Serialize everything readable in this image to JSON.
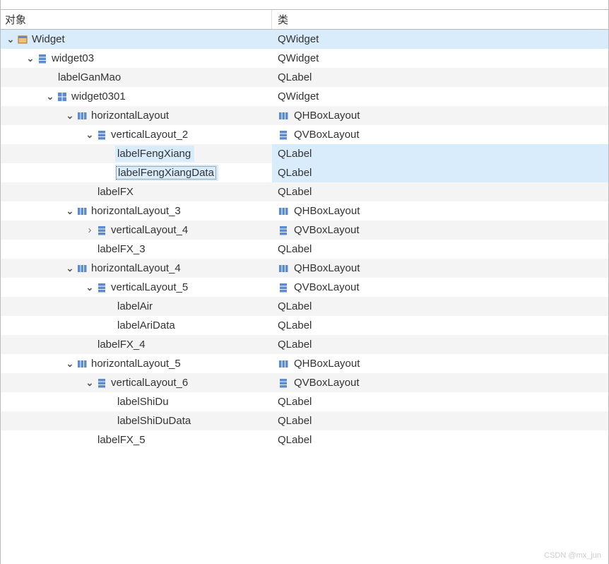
{
  "header": {
    "object": "对象",
    "class": "类"
  },
  "watermark": "CSDN @mx_jun",
  "icons": {
    "widget": "widget",
    "vbox": "vbox",
    "hbox": "hbox",
    "grid": "grid"
  },
  "rows": [
    {
      "indent": 0,
      "arrow": "open",
      "icon": "widget",
      "name": "Widget",
      "cls": "QWidget",
      "clsIcon": "",
      "sel": true,
      "alt": false,
      "subsel": false,
      "focused": false
    },
    {
      "indent": 1,
      "arrow": "open",
      "icon": "vbox",
      "name": "widget03",
      "cls": "QWidget",
      "clsIcon": "",
      "sel": false,
      "alt": false,
      "subsel": false,
      "focused": false
    },
    {
      "indent": 2,
      "arrow": "none",
      "icon": "",
      "name": "labelGanMao",
      "cls": "QLabel",
      "clsIcon": "",
      "sel": false,
      "alt": true,
      "subsel": false,
      "focused": false
    },
    {
      "indent": 2,
      "arrow": "open",
      "icon": "grid",
      "name": "widget0301",
      "cls": "QWidget",
      "clsIcon": "",
      "sel": false,
      "alt": false,
      "subsel": false,
      "focused": false
    },
    {
      "indent": 3,
      "arrow": "open",
      "icon": "hbox",
      "name": "horizontalLayout",
      "cls": "QHBoxLayout",
      "clsIcon": "hbox",
      "sel": false,
      "alt": true,
      "subsel": false,
      "focused": false
    },
    {
      "indent": 4,
      "arrow": "open",
      "icon": "vbox",
      "name": "verticalLayout_2",
      "cls": "QVBoxLayout",
      "clsIcon": "vbox",
      "sel": false,
      "alt": false,
      "subsel": false,
      "focused": false
    },
    {
      "indent": 5,
      "arrow": "none",
      "icon": "",
      "name": "labelFengXiang",
      "cls": "QLabel",
      "clsIcon": "",
      "sel": false,
      "alt": true,
      "subsel": true,
      "focused": false
    },
    {
      "indent": 5,
      "arrow": "none",
      "icon": "",
      "name": "labelFengXiangData",
      "cls": "QLabel",
      "clsIcon": "",
      "sel": false,
      "alt": false,
      "subsel": true,
      "focused": true
    },
    {
      "indent": 4,
      "arrow": "none",
      "icon": "",
      "name": "labelFX",
      "cls": "QLabel",
      "clsIcon": "",
      "sel": false,
      "alt": true,
      "subsel": false,
      "focused": false
    },
    {
      "indent": 3,
      "arrow": "open",
      "icon": "hbox",
      "name": "horizontalLayout_3",
      "cls": "QHBoxLayout",
      "clsIcon": "hbox",
      "sel": false,
      "alt": false,
      "subsel": false,
      "focused": false
    },
    {
      "indent": 4,
      "arrow": "closed",
      "icon": "vbox",
      "name": "verticalLayout_4",
      "cls": "QVBoxLayout",
      "clsIcon": "vbox",
      "sel": false,
      "alt": true,
      "subsel": false,
      "focused": false
    },
    {
      "indent": 4,
      "arrow": "none",
      "icon": "",
      "name": "labelFX_3",
      "cls": "QLabel",
      "clsIcon": "",
      "sel": false,
      "alt": false,
      "subsel": false,
      "focused": false
    },
    {
      "indent": 3,
      "arrow": "open",
      "icon": "hbox",
      "name": "horizontalLayout_4",
      "cls": "QHBoxLayout",
      "clsIcon": "hbox",
      "sel": false,
      "alt": true,
      "subsel": false,
      "focused": false
    },
    {
      "indent": 4,
      "arrow": "open",
      "icon": "vbox",
      "name": "verticalLayout_5",
      "cls": "QVBoxLayout",
      "clsIcon": "vbox",
      "sel": false,
      "alt": false,
      "subsel": false,
      "focused": false
    },
    {
      "indent": 5,
      "arrow": "none",
      "icon": "",
      "name": "labelAir",
      "cls": "QLabel",
      "clsIcon": "",
      "sel": false,
      "alt": true,
      "subsel": false,
      "focused": false
    },
    {
      "indent": 5,
      "arrow": "none",
      "icon": "",
      "name": "labelAriData",
      "cls": "QLabel",
      "clsIcon": "",
      "sel": false,
      "alt": false,
      "subsel": false,
      "focused": false
    },
    {
      "indent": 4,
      "arrow": "none",
      "icon": "",
      "name": "labelFX_4",
      "cls": "QLabel",
      "clsIcon": "",
      "sel": false,
      "alt": true,
      "subsel": false,
      "focused": false
    },
    {
      "indent": 3,
      "arrow": "open",
      "icon": "hbox",
      "name": "horizontalLayout_5",
      "cls": "QHBoxLayout",
      "clsIcon": "hbox",
      "sel": false,
      "alt": false,
      "subsel": false,
      "focused": false
    },
    {
      "indent": 4,
      "arrow": "open",
      "icon": "vbox",
      "name": "verticalLayout_6",
      "cls": "QVBoxLayout",
      "clsIcon": "vbox",
      "sel": false,
      "alt": true,
      "subsel": false,
      "focused": false
    },
    {
      "indent": 5,
      "arrow": "none",
      "icon": "",
      "name": "labelShiDu",
      "cls": "QLabel",
      "clsIcon": "",
      "sel": false,
      "alt": false,
      "subsel": false,
      "focused": false
    },
    {
      "indent": 5,
      "arrow": "none",
      "icon": "",
      "name": "labelShiDuData",
      "cls": "QLabel",
      "clsIcon": "",
      "sel": false,
      "alt": true,
      "subsel": false,
      "focused": false
    },
    {
      "indent": 4,
      "arrow": "none",
      "icon": "",
      "name": "labelFX_5",
      "cls": "QLabel",
      "clsIcon": "",
      "sel": false,
      "alt": false,
      "subsel": false,
      "focused": false
    }
  ]
}
